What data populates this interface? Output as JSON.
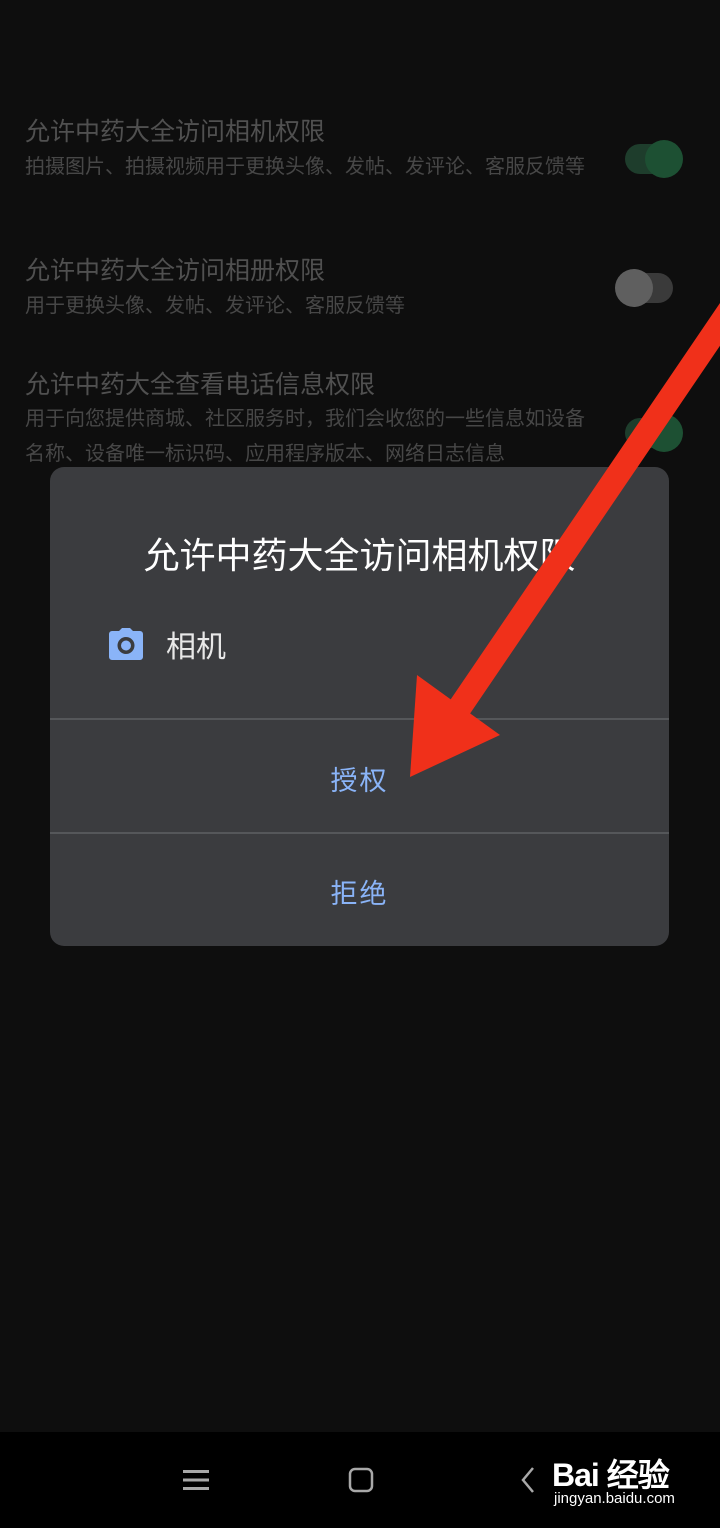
{
  "permissions": [
    {
      "title": "允许中药大全访问相机权限",
      "description": "拍摄图片、拍摄视频用于更换头像、发帖、发评论、客服反馈等",
      "enabled": true
    },
    {
      "title": "允许中药大全访问相册权限",
      "description": "用于更换头像、发帖、发评论、客服反馈等",
      "enabled": false
    },
    {
      "title": "允许中药大全查看电话信息权限",
      "description": "用于向您提供商城、社区服务时，我们会收您的一些信息如设备名称、设备唯一标识码、应用程序版本、网络日志信息",
      "enabled": true
    }
  ],
  "dialog": {
    "title": "允许中药大全访问相机权限",
    "permission_icon": "camera-icon",
    "permission_label": "相机",
    "allow_label": "授权",
    "deny_label": "拒绝",
    "accent_color": "#8ab4f8"
  },
  "annotation": {
    "arrow_color": "#f0301a"
  },
  "navbar": {
    "menu_icon": "menu-icon",
    "home_icon": "home-icon",
    "back_icon": "back-icon"
  },
  "watermark": {
    "logo_text": "Bai 经验",
    "url": "jingyan.baidu.com"
  }
}
